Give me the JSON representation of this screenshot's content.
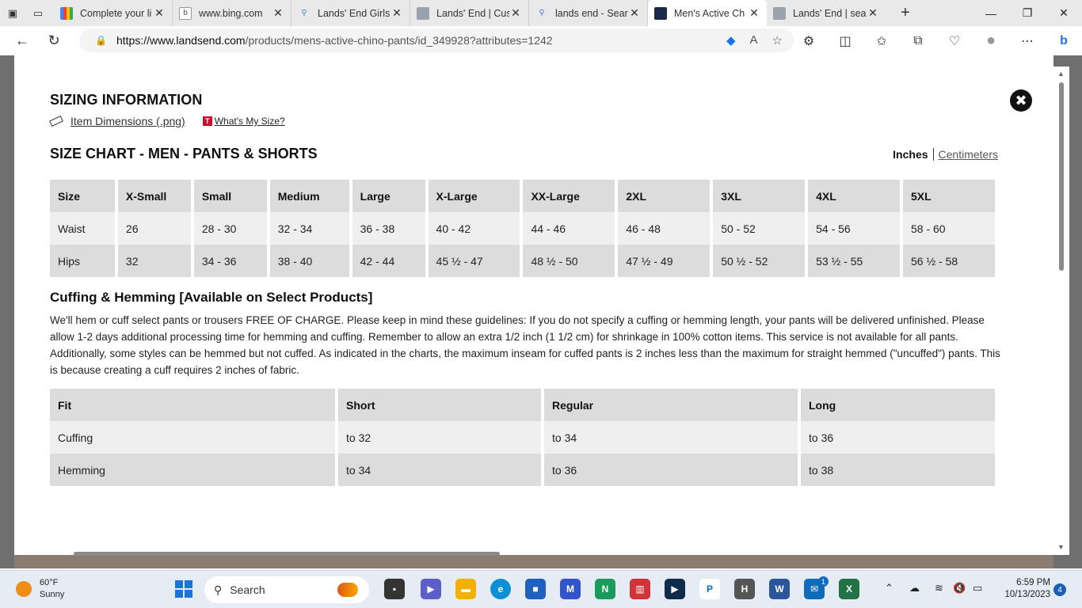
{
  "browser": {
    "tabs": [
      {
        "title": "Complete your li",
        "icon": "google-forms-icon",
        "active": false
      },
      {
        "title": "www.bing.com",
        "icon": "bing-icon",
        "active": false
      },
      {
        "title": "Lands' End Girls",
        "icon": "search-icon",
        "active": false
      },
      {
        "title": "Lands' End | Cus",
        "icon": "landsend-icon",
        "active": false
      },
      {
        "title": "lands end - Sear",
        "icon": "search-icon",
        "active": false
      },
      {
        "title": "Men's Active Ch",
        "icon": "landsend-icon",
        "active": true
      },
      {
        "title": "Lands' End | sea",
        "icon": "landsend-icon",
        "active": false
      }
    ],
    "url_host": "https://www.landsend.com",
    "url_path": "/products/mens-active-chino-pants/id_349928?attributes=1242"
  },
  "modal": {
    "title": "SIZING INFORMATION",
    "item_dimensions_link": "Item Dimensions (.png)",
    "whats_my_size_badge": "T",
    "whats_my_size_link": "What's My Size?",
    "chart_title": "SIZE CHART - MEN - PANTS & SHORTS",
    "unit_inches": "Inches",
    "unit_cm": "Centimeters",
    "close_symbol": "✖",
    "size_table": {
      "header": [
        "Size",
        "X-Small",
        "Small",
        "Medium",
        "Large",
        "X-Large",
        "XX-Large",
        "2XL",
        "3XL",
        "4XL",
        "5XL"
      ],
      "rows": [
        [
          "Waist",
          "26",
          "28 - 30",
          "32 - 34",
          "36 - 38",
          "40 - 42",
          "44 - 46",
          "46 - 48",
          "50 - 52",
          "54 - 56",
          "58 - 60"
        ],
        [
          "Hips",
          "32",
          "34 - 36",
          "38 - 40",
          "42 - 44",
          "45 ½ - 47",
          "48 ½ - 50",
          "47 ½ - 49",
          "50 ½ - 52",
          "53 ½ - 55",
          "56 ½ - 58"
        ]
      ]
    },
    "cuffing_title": "Cuffing & Hemming [Available on Select Products]",
    "cuffing_text": "We'll hem or cuff select pants or trousers FREE OF CHARGE. Please keep in mind these guidelines: If you do not specify a cuffing or hemming length, your pants will be delivered unfinished. Please allow 1-2 days additional processing time for hemming and cuffing. Remember to allow an extra 1/2 inch (1 1/2 cm) for shrinkage in 100% cotton items. This service is not available for all pants. Additionally, some styles can be hemmed but not cuffed. As indicated in the charts, the maximum inseam for cuffed pants is 2 inches less than the maximum for straight hemmed (\"uncuffed\") pants. This is because creating a cuff requires 2 inches of fabric.",
    "fit_table": {
      "header": [
        "Fit",
        "Short",
        "Regular",
        "Long"
      ],
      "rows": [
        [
          "Cuffing",
          "to 32",
          "to 34",
          "to 36"
        ],
        [
          "Hemming",
          "to 34",
          "to 36",
          "to 38"
        ]
      ]
    }
  },
  "taskbar": {
    "weather_temp": "60°F",
    "weather_desc": "Sunny",
    "search_label": "Search",
    "time": "6:59 PM",
    "date": "10/13/2023",
    "notification_count": "4",
    "mail_badge": "1"
  }
}
